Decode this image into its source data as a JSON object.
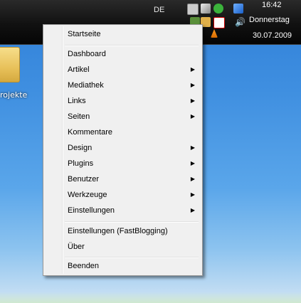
{
  "taskbar": {
    "language": "DE",
    "time": "16:42",
    "day": "Donnerstag",
    "date": "30.07.2009",
    "tray_icons": [
      "app-icon",
      "cube-icon",
      "refresh-icon",
      "network-icon",
      "shield-icon",
      "folder-icon",
      "antivirus-icon",
      "vlc-icon",
      "speaker-icon"
    ]
  },
  "desktop": {
    "folder_label": "rojekte"
  },
  "menu": {
    "items": [
      {
        "label": "Startseite",
        "submenu": false
      },
      {
        "label": "Dashboard",
        "submenu": false
      },
      {
        "label": "Artikel",
        "submenu": true
      },
      {
        "label": "Mediathek",
        "submenu": true
      },
      {
        "label": "Links",
        "submenu": true
      },
      {
        "label": "Seiten",
        "submenu": true
      },
      {
        "label": "Kommentare",
        "submenu": false
      },
      {
        "label": "Design",
        "submenu": true
      },
      {
        "label": "Plugins",
        "submenu": true
      },
      {
        "label": "Benutzer",
        "submenu": true
      },
      {
        "label": "Werkzeuge",
        "submenu": true
      },
      {
        "label": "Einstellungen",
        "submenu": true
      },
      {
        "label": "Einstellungen (FastBlogging)",
        "submenu": false
      },
      {
        "label": "Über",
        "submenu": false
      },
      {
        "label": "Beenden",
        "submenu": false
      }
    ],
    "arrow_glyph": "▶"
  }
}
